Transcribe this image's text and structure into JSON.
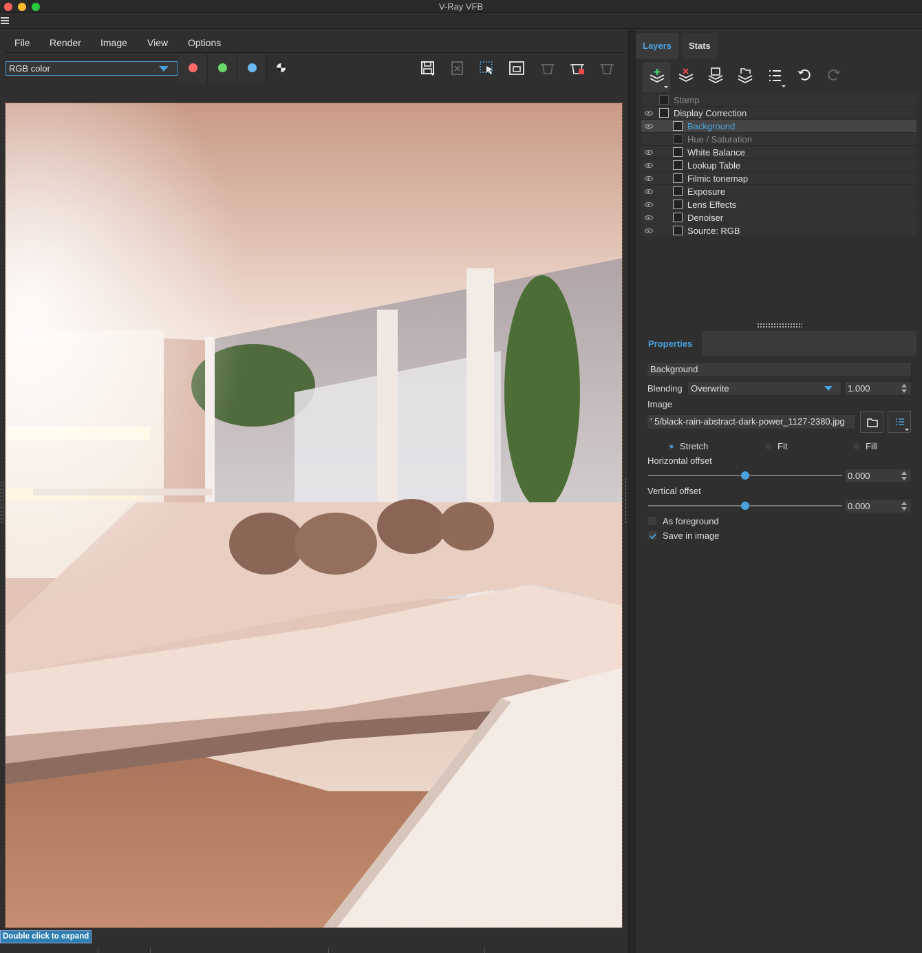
{
  "window": {
    "title": "V-Ray VFB"
  },
  "menu": [
    "File",
    "Render",
    "Image",
    "View",
    "Options"
  ],
  "channel_select": {
    "value": "RGB color"
  },
  "colors": {
    "red": "#ff6b6b",
    "green": "#6cd86c",
    "blue": "#6cbcf2",
    "accent": "#4aa3df"
  },
  "toolbar_icons": [
    "save-icon",
    "clear-image-icon",
    "region-render-icon",
    "lens-icon",
    "render-last-icon",
    "render-icon",
    "stop-render-icon"
  ],
  "status": {
    "hint": "Double click to expand"
  },
  "right": {
    "tabs": [
      "Layers",
      "Stats"
    ],
    "layer_tools": [
      "add-layer-icon",
      "delete-layer-icon",
      "save-layers-icon",
      "load-layers-icon",
      "layer-list-icon",
      "undo-icon",
      "redo-icon"
    ],
    "layers": [
      {
        "label": "Stamp",
        "eye": false,
        "indent": 0,
        "dim": true
      },
      {
        "label": "Display Correction",
        "eye": true,
        "indent": 0,
        "dim": false
      },
      {
        "label": "Background",
        "eye": true,
        "indent": 1,
        "dim": false,
        "selected": true
      },
      {
        "label": "Hue / Saturation",
        "eye": false,
        "indent": 1,
        "dim": true
      },
      {
        "label": "White Balance",
        "eye": true,
        "indent": 1,
        "dim": false
      },
      {
        "label": "Lookup Table",
        "eye": true,
        "indent": 1,
        "dim": false
      },
      {
        "label": "Filmic tonemap",
        "eye": true,
        "indent": 1,
        "dim": false
      },
      {
        "label": "Exposure",
        "eye": true,
        "indent": 1,
        "dim": false
      },
      {
        "label": "Lens Effects",
        "eye": true,
        "indent": 1,
        "dim": false
      },
      {
        "label": "Denoiser",
        "eye": true,
        "indent": 1,
        "dim": false
      },
      {
        "label": "Source: RGB",
        "eye": true,
        "indent": 1,
        "dim": false
      }
    ],
    "properties": {
      "tab": "Properties",
      "name": "Background",
      "blending_label": "Blending",
      "blending_value": "Overwrite",
      "opacity": "1.000",
      "image_label": "Image",
      "image_path": "' 5/black-rain-abstract-dark-power_1127-2380.jpg",
      "fit_options": [
        "Stretch",
        "Fit",
        "Fill"
      ],
      "fit_selected": "Stretch",
      "h_offset_label": "Horizontal offset",
      "h_offset": "0.000",
      "v_offset_label": "Vertical offset",
      "v_offset": "0.000",
      "as_foreground_label": "As foreground",
      "as_foreground": false,
      "save_in_image_label": "Save in image",
      "save_in_image": true
    }
  }
}
